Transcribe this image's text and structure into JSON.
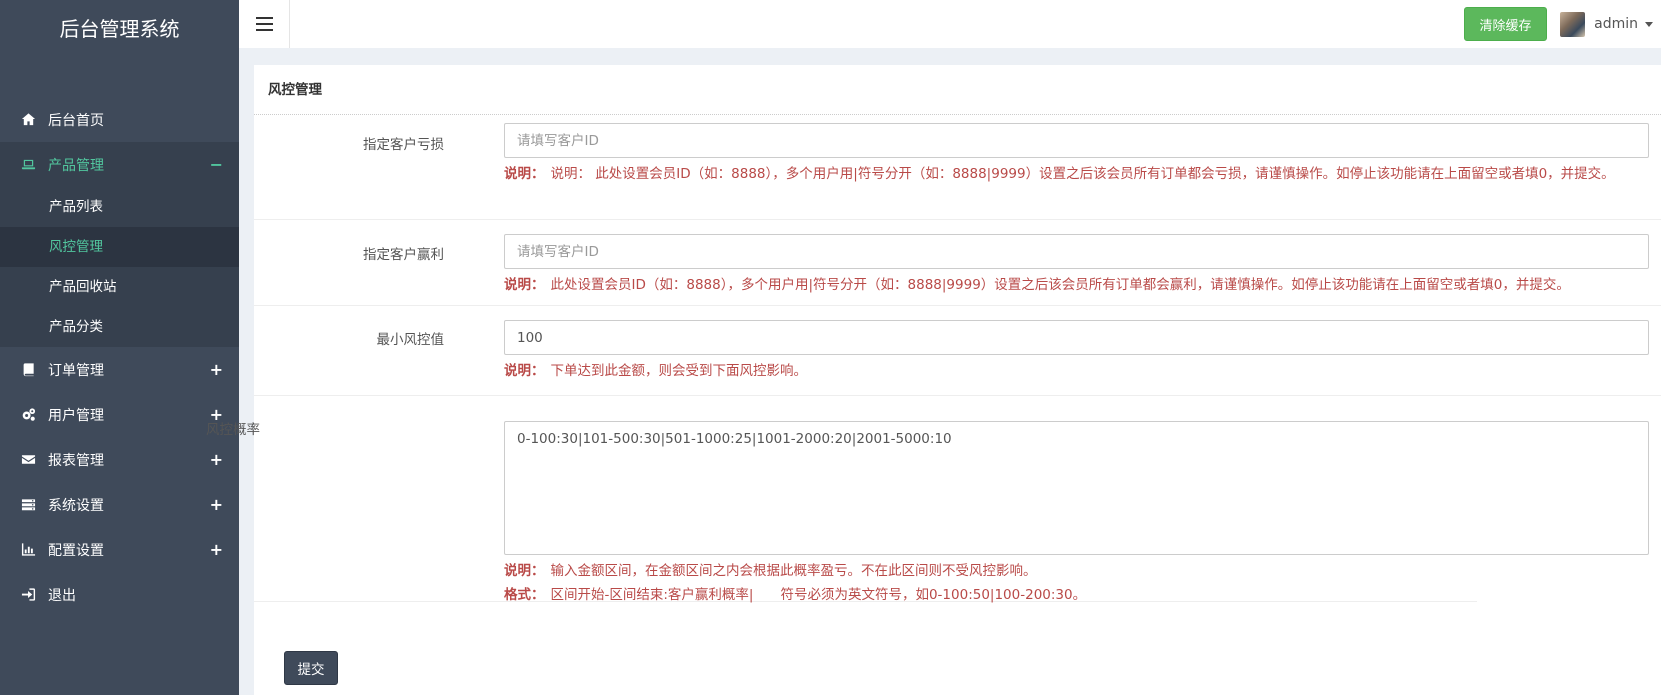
{
  "brand": "后台管理系统",
  "sidebar": {
    "items": [
      {
        "label": "后台首页",
        "icon": "home-icon",
        "toggle": ""
      },
      {
        "label": "产品管理",
        "icon": "laptop-icon",
        "toggle": "−"
      },
      {
        "label": "订单管理",
        "icon": "book-icon",
        "toggle": "+"
      },
      {
        "label": "用户管理",
        "icon": "gears-icon",
        "toggle": "+"
      },
      {
        "label": "报表管理",
        "icon": "envelope-icon",
        "toggle": "+"
      },
      {
        "label": "系统设置",
        "icon": "server-icon",
        "toggle": "+"
      },
      {
        "label": "配置设置",
        "icon": "bar-chart-icon",
        "toggle": "+"
      },
      {
        "label": "退出",
        "icon": "sign-out-icon",
        "toggle": ""
      }
    ],
    "submenu": [
      "产品列表",
      "风控管理",
      "产品回收站",
      "产品分类"
    ]
  },
  "header": {
    "clear_cache": "清除缓存",
    "username": "admin"
  },
  "panel": {
    "title": "风控管理",
    "rows": [
      {
        "label": "指定客户亏损",
        "placeholder": "请填写客户ID",
        "help_label": "说明：",
        "help_text": "说明： 此处设置会员ID（如：8888），多个用户用|符号分开（如：8888|9999）设置之后该会员所有订单都会亏损，请谨慎操作。如停止该功能请在上面留空或者填0，并提交。"
      },
      {
        "label": "指定客户赢利",
        "placeholder": "请填写客户ID",
        "help_label": "说明：",
        "help_text": "此处设置会员ID（如：8888），多个用户用|符号分开（如：8888|9999）设置之后该会员所有订单都会赢利，请谨慎操作。如停止该功能请在上面留空或者填0，并提交。"
      },
      {
        "label": "最小风控值",
        "value": "100",
        "help_label": "说明：",
        "help_text": "下单达到此金额，则会受到下面风控影响。"
      },
      {
        "label": "风控概率",
        "value": "0-100:30|101-500:30|501-1000:25|1001-2000:20|2001-5000:10",
        "help_label": "说明：",
        "help_text": "输入金额区间，在金额区间之内会根据此概率盈亏。不在此区间则不受风控影响。",
        "format_label": "格式：",
        "format_text": "区间开始-区间结束:客户赢利概率|　　符号必须为英文符号，如0-100:50|100-200:30。"
      }
    ],
    "submit": "提交"
  }
}
